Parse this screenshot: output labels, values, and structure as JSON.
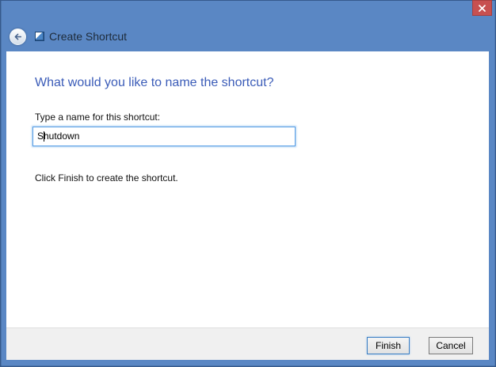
{
  "window": {
    "title": "Create Shortcut"
  },
  "main": {
    "heading": "What would you like to name the shortcut?",
    "name_label": "Type a name for this shortcut:",
    "name_value": "Shutdown",
    "instruction": "Click Finish to create the shortcut."
  },
  "footer": {
    "finish_label": "Finish",
    "cancel_label": "Cancel"
  },
  "icons": {
    "back": "back-arrow",
    "close": "close-x",
    "shortcut": "shortcut-overlay"
  },
  "colors": {
    "titlebar_blue": "#5a87c4",
    "window_border": "#35598c",
    "title_text": "#1e2b3a",
    "heading_text": "#3b5cb8",
    "close_button_red": "#c75050",
    "footer_bg": "#f0f0f0",
    "footer_border": "#dfdfdf",
    "input_focus_border": "#569de5",
    "finish_button_border": "#3e80c4",
    "cancel_button_border": "#7a7a7a",
    "button_bg": "#e9e9e9"
  }
}
